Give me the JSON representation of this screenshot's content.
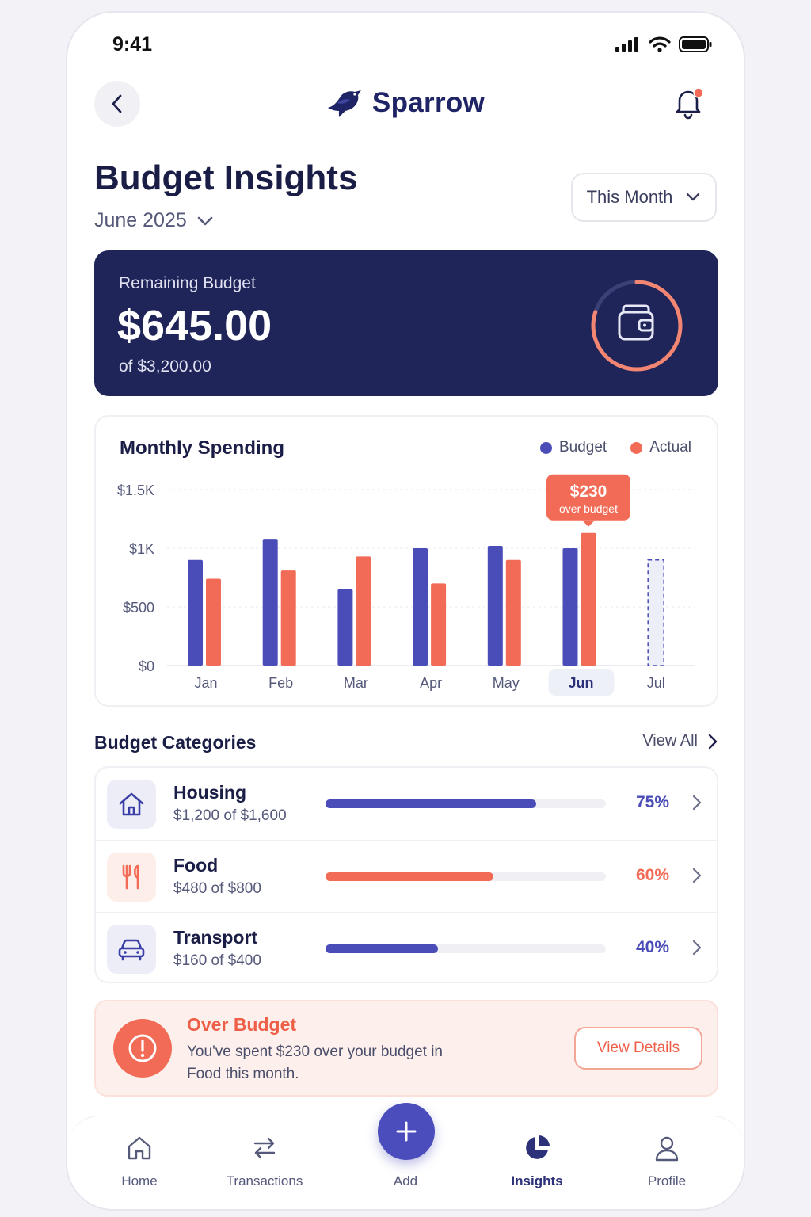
{
  "status_bar": {
    "time": "9:41"
  },
  "header": {
    "brand": "Sparrow",
    "has_notification": true
  },
  "page": {
    "title": "Budget Insights",
    "month": "June 2025",
    "period_selector": "This Month"
  },
  "remaining": {
    "label": "Remaining Budget",
    "amount": "$645.00",
    "total": "of $3,200.00",
    "ring_progress": 0.8
  },
  "chart": {
    "title": "Monthly Spending",
    "legend": {
      "budget": "Budget",
      "actual": "Actual"
    },
    "callout": {
      "amount": "$230",
      "note": "over budget"
    },
    "colors": {
      "budget": "#4a4db8",
      "actual": "#f26b56"
    }
  },
  "chart_data": {
    "type": "bar",
    "title": "Monthly Spending",
    "categories": [
      "Jan",
      "Feb",
      "Mar",
      "Apr",
      "May",
      "Jun",
      "Jul"
    ],
    "series": [
      {
        "name": "Budget",
        "values": [
          900,
          1080,
          650,
          1000,
          1020,
          1000,
          900
        ]
      },
      {
        "name": "Actual",
        "values": [
          740,
          810,
          930,
          700,
          900,
          1130,
          null
        ]
      }
    ],
    "projected_month": "Jul",
    "highlighted_month": "Jun",
    "y_tick_labels": [
      "$0",
      "$500",
      "$1K",
      "$1.5K"
    ],
    "y_ticks": [
      0,
      500,
      1000,
      1500
    ],
    "ylim": [
      0,
      1500
    ],
    "grid": true,
    "legend_position": "top-right"
  },
  "categories": {
    "title": "Budget Categories",
    "view_all": "View All",
    "items": [
      {
        "name": "Housing",
        "amount": "$1,200 of $1,600",
        "percent": "75%",
        "fraction": 0.75,
        "color": "#4a4db8",
        "icon": "house-icon"
      },
      {
        "name": "Food",
        "amount": "$480 of $800",
        "percent": "60%",
        "fraction": 0.6,
        "color": "#f26b56",
        "icon": "fork-knife-icon"
      },
      {
        "name": "Transport",
        "amount": "$160 of $400",
        "percent": "40%",
        "fraction": 0.4,
        "color": "#4a4db8",
        "icon": "car-icon"
      }
    ]
  },
  "alert": {
    "title": "Over Budget",
    "message": "You've spent $230 over your budget in Food this month.",
    "button": "View Details"
  },
  "tabbar": {
    "home": "Home",
    "transactions": "Transactions",
    "add": "Add",
    "insights": "Insights",
    "profile": "Profile",
    "active": "Insights"
  }
}
